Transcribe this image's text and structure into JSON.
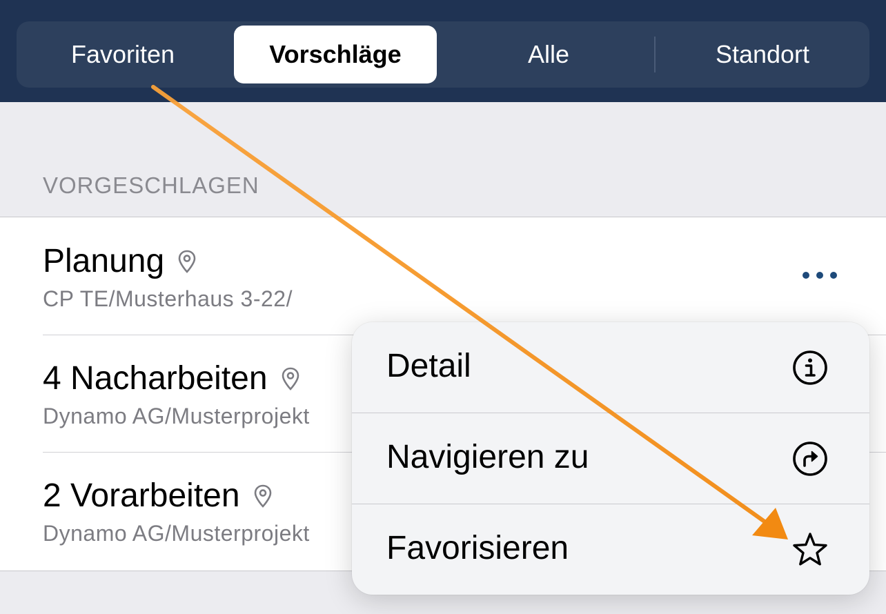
{
  "tabs": [
    {
      "label": "Favoriten",
      "selected": false
    },
    {
      "label": "Vorschläge",
      "selected": true
    },
    {
      "label": "Alle",
      "selected": false
    },
    {
      "label": "Standort",
      "selected": false
    }
  ],
  "section": {
    "header": "VORGESCHLAGEN"
  },
  "items": [
    {
      "title": "Planung",
      "subtitle": "CP TE/Musterhaus 3-22/",
      "icon": "location-pin-icon"
    },
    {
      "title": "4 Nacharbeiten",
      "subtitle": "Dynamo AG/Musterprojekt",
      "icon": "location-pin-icon"
    },
    {
      "title": "2 Vorarbeiten",
      "subtitle": "Dynamo AG/Musterprojekt",
      "icon": "location-pin-icon"
    }
  ],
  "context_menu": {
    "items": [
      {
        "label": "Detail",
        "icon": "info-circle-icon"
      },
      {
        "label": "Navigieren zu",
        "icon": "navigate-arrow-icon"
      },
      {
        "label": "Favorisieren",
        "icon": "star-icon"
      }
    ]
  },
  "colors": {
    "header_bg": "#1f3353",
    "segment_bg": "#2d405d",
    "accent_dots": "#1e4a7a",
    "annotation_arrow": "#f7941d"
  }
}
